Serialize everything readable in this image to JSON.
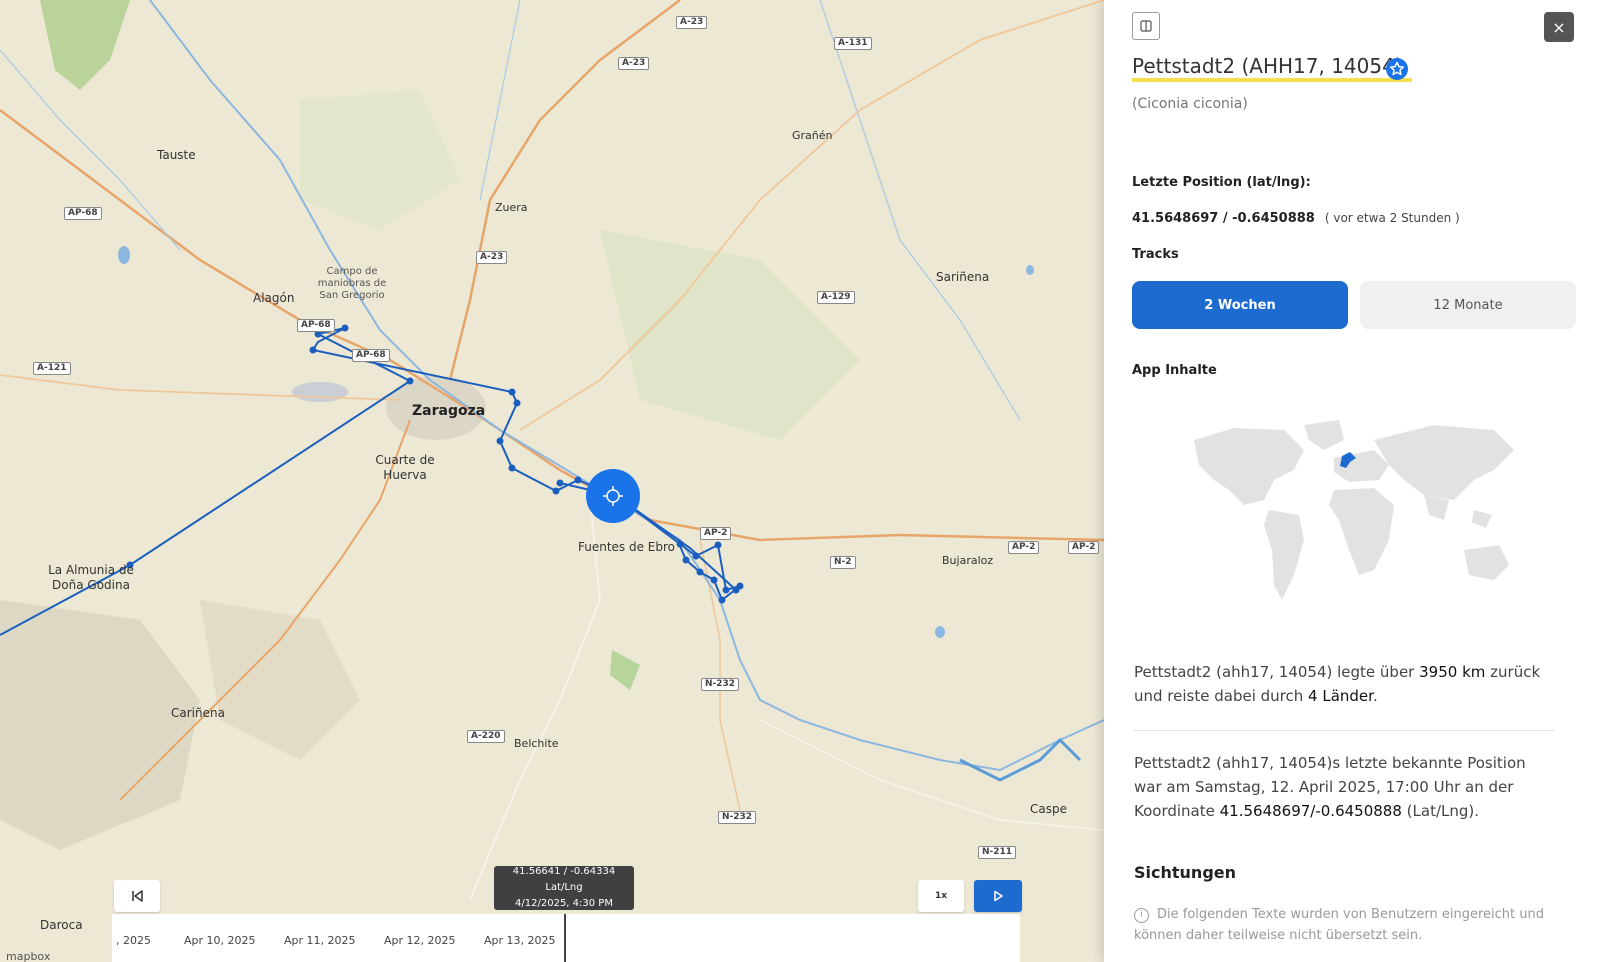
{
  "map": {
    "places": [
      {
        "name": "Tauste",
        "kind": "town"
      },
      {
        "name": "Zuera",
        "kind": "town"
      },
      {
        "name": "Grañén",
        "kind": "town"
      },
      {
        "name": "Sariñena",
        "kind": "town"
      },
      {
        "name": "Campo de maniobras de San Gregorio",
        "kind": "area"
      },
      {
        "name": "Alagón",
        "kind": "town"
      },
      {
        "name": "Zaragoza",
        "kind": "city"
      },
      {
        "name": "Cuarte de Huerva",
        "kind": "town"
      },
      {
        "name": "Fuentes de Ebro",
        "kind": "town"
      },
      {
        "name": "Bujaraloz",
        "kind": "town"
      },
      {
        "name": "La Almunia de Doña Godina",
        "kind": "town"
      },
      {
        "name": "Cariñena",
        "kind": "town"
      },
      {
        "name": "Belchite",
        "kind": "town"
      },
      {
        "name": "Caspe",
        "kind": "town"
      },
      {
        "name": "Daroca",
        "kind": "town"
      }
    ],
    "roads": [
      "A-23",
      "A-23",
      "A-131",
      "AP-68",
      "A-23",
      "A-129",
      "AP-68",
      "AP-68",
      "A-121",
      "AP-2",
      "AP-2",
      "AP-2",
      "N-2",
      "N-232",
      "A-220",
      "N-232",
      "N-211"
    ],
    "track_color": "#1a5fbf",
    "current_marker_color": "#1a73e8",
    "tooltip": {
      "coords": "41.56641 / -0.64334 Lat/Lng",
      "datetime": "4/12/2025, 4:30 PM"
    },
    "speed_label": "1x",
    "timeline_dates": [
      ", 2025",
      "Apr 10, 2025",
      "Apr 11, 2025",
      "Apr 12, 2025",
      "Apr 13, 2025"
    ],
    "attribution": "mapbox",
    "icons": {
      "rewind": "skip-back-icon",
      "play": "play-icon"
    }
  },
  "panel": {
    "title": "Pettstadt2 (AHH17, 14054)",
    "species": "(Ciconia ciconia)",
    "last_position_label": "Letzte Position (lat/lng):",
    "last_position_value": "41.5648697 / -0.6450888",
    "last_position_relative": "( vor etwa 2 Stunden )",
    "tracks_label": "Tracks",
    "tab_2weeks": "2 Wochen",
    "tab_12months": "12 Monate",
    "app_content_label": "App Inhalte",
    "summary_1": "Pettstadt2 (ahh17, 14054) legte über",
    "summary_km": "3950 km",
    "summary_2": "zurück und reiste dabei durch",
    "summary_countries": "4 Länder",
    "summary_3": ".",
    "last_known_1": "Pettstadt2 (ahh17, 14054)s letzte bekannte Position war am Samstag, 12. April 2025, 17:00 Uhr an der Koordinate",
    "last_known_coords": "41.5648697/-0.6450888",
    "last_known_2": "(Lat/Lng).",
    "sightings_label": "Sichtungen",
    "sightings_note": "Die folgenden Texte wurden von Benutzern eingereicht und können daher teilweise nicht übersetzt sein.",
    "close_label": "×",
    "accent": "#1e6bd0",
    "highlight": "#f5e04c"
  }
}
